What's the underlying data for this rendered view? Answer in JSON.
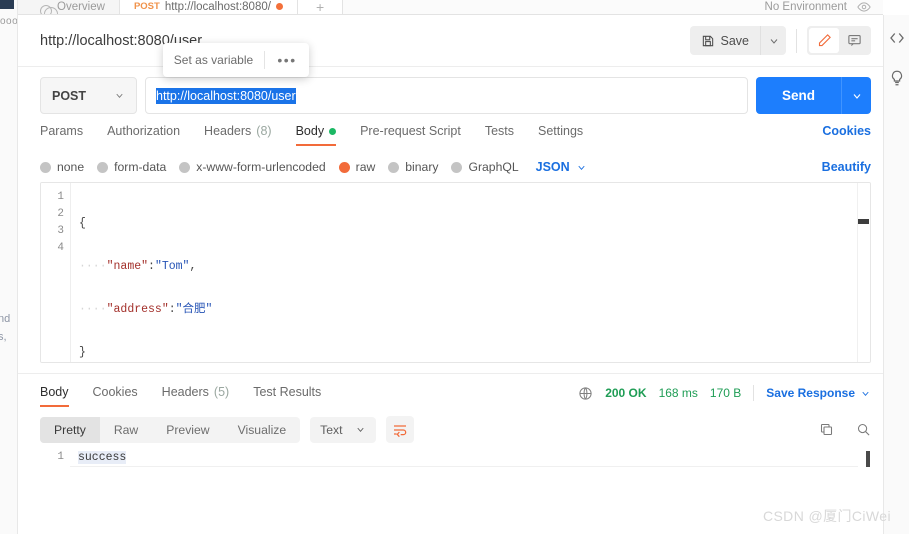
{
  "tabstrip": {
    "tabs": [
      {
        "label": "Overview",
        "icon": "overview-icon",
        "active": false
      },
      {
        "method": "POST",
        "label": "http://localhost:8080/",
        "unsaved": true,
        "active": true
      },
      {
        "label": "+",
        "active": false
      }
    ],
    "environment": "No Environment"
  },
  "request": {
    "title": "http://localhost:8080/user",
    "save_label": "Save",
    "method": "POST",
    "url": "http://localhost:8080/user",
    "send_label": "Send",
    "tabs": [
      {
        "label": "Params",
        "count": "",
        "active": false
      },
      {
        "label": "Authorization",
        "count": "",
        "active": false
      },
      {
        "label": "Headers",
        "count": "(8)",
        "active": false
      },
      {
        "label": "Body",
        "count": "",
        "active": true,
        "dot": true
      },
      {
        "label": "Pre-request Script",
        "count": "",
        "active": false
      },
      {
        "label": "Tests",
        "count": "",
        "active": false
      },
      {
        "label": "Settings",
        "count": "",
        "active": false
      }
    ],
    "cookies_link": "Cookies",
    "beautify_link": "Beautify",
    "body_types": [
      {
        "label": "none",
        "selected": false
      },
      {
        "label": "form-data",
        "selected": false
      },
      {
        "label": "x-www-form-urlencoded",
        "selected": false
      },
      {
        "label": "raw",
        "selected": true
      },
      {
        "label": "binary",
        "selected": false
      },
      {
        "label": "GraphQL",
        "selected": false
      }
    ],
    "raw_format": "JSON",
    "body_lines": [
      "1",
      "2",
      "3",
      "4"
    ],
    "body_code": {
      "line1": "{",
      "line2_key": "\"name\"",
      "line2_colon": ":",
      "line2_val": "\"Tom\"",
      "line2_comma": ",",
      "line3_key": "\"address\"",
      "line3_colon": ":",
      "line3_val": "\"合肥\"",
      "line4": "}",
      "indent": "····"
    }
  },
  "popover": {
    "set_as_variable": "Set as variable",
    "more": "•••"
  },
  "response": {
    "tabs": [
      {
        "label": "Body",
        "count": "",
        "active": true
      },
      {
        "label": "Cookies",
        "count": "",
        "active": false
      },
      {
        "label": "Headers",
        "count": "(5)",
        "active": false
      },
      {
        "label": "Test Results",
        "count": "",
        "active": false
      }
    ],
    "status": "200 OK",
    "time": "168 ms",
    "size": "170 B",
    "save_response": "Save Response",
    "view_modes": [
      {
        "label": "Pretty",
        "active": true
      },
      {
        "label": "Raw",
        "active": false
      },
      {
        "label": "Preview",
        "active": false
      },
      {
        "label": "Visualize",
        "active": false
      }
    ],
    "format": "Text",
    "line_number": "1",
    "body_text": "success"
  },
  "watermark": "CSDN @厦门CiWei",
  "colors": {
    "accent_orange": "#f26b3a",
    "link_blue": "#1a6fe0",
    "send_blue": "#1d7efd",
    "status_green": "#1f9d55",
    "selection_blue": "#1a73e8"
  }
}
